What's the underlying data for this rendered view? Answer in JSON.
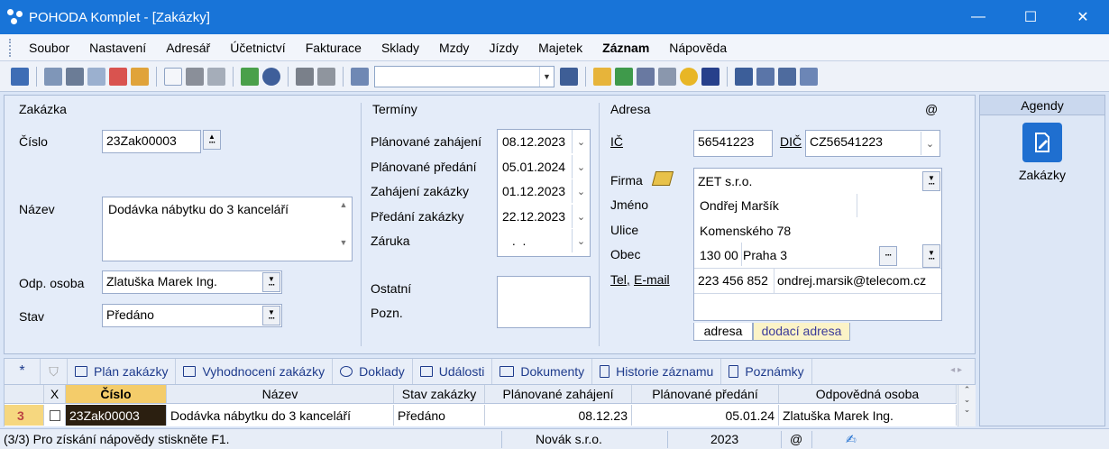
{
  "window": {
    "title": "POHODA Komplet - [Zakázky]",
    "minimize": "—",
    "maximize": "☐",
    "close": "✕"
  },
  "menu": [
    {
      "label": "Soubor"
    },
    {
      "label": "Nastavení"
    },
    {
      "label": "Adresář"
    },
    {
      "label": "Účetnictví"
    },
    {
      "label": "Fakturace"
    },
    {
      "label": "Sklady"
    },
    {
      "label": "Mzdy"
    },
    {
      "label": "Jízdy"
    },
    {
      "label": "Majetek"
    },
    {
      "label": "Záznam",
      "bold": true
    },
    {
      "label": "Nápověda"
    }
  ],
  "toolbar": {
    "combo_value": ""
  },
  "zakazka": {
    "section": "Zakázka",
    "cislo_label": "Číslo",
    "cislo_value": "23Zak00003",
    "nazev_label": "Název",
    "nazev_value": "Dodávka nábytku do 3 kanceláří",
    "odp_label": "Odp. osoba",
    "odp_value": "Zlatuška Marek Ing.",
    "stav_label": "Stav",
    "stav_value": "Předáno"
  },
  "terminy": {
    "section": "Termíny",
    "rows": [
      {
        "label": "Plánované zahájení",
        "value": "08.12.2023"
      },
      {
        "label": "Plánované předání",
        "value": "05.01.2024"
      },
      {
        "label": "Zahájení zakázky",
        "value": "01.12.2023"
      },
      {
        "label": "Předání zakázky",
        "value": "22.12.2023"
      },
      {
        "label": "Záruka",
        "value": " .  ."
      }
    ],
    "ostatni_label": "Ostatní",
    "pozn_label": "Pozn.",
    "ostatni_value": ""
  },
  "adresa": {
    "section": "Adresa",
    "at": "@",
    "ic_label": "IČ",
    "ic_value": "56541223",
    "dic_label": "DIČ",
    "dic_value": "CZ56541223",
    "firma_label": "Firma",
    "firma_value": "ZET s.r.o.",
    "jmeno_label": "Jméno",
    "jmeno_value": "Ondřej Maršík",
    "ulice_label": "Ulice",
    "ulice_value": "Komenského 78",
    "obec_label": "Obec",
    "psc_value": "130 00",
    "obec_value": "Praha 3",
    "tel_label": "Tel,",
    "email_label": "E-mail",
    "tel_value": "223 456 852",
    "email_value": "ondrej.marsik@telecom.cz",
    "tab1": "adresa",
    "tab2": "dodací adresa"
  },
  "agendy": {
    "head": "Agendy",
    "item": "Zakázky"
  },
  "tabs": [
    {
      "label": "Plán zakázky",
      "icon": "list-icon"
    },
    {
      "label": "Vyhodnocení zakázky",
      "icon": "list-icon"
    },
    {
      "label": "Doklady",
      "icon": "info-icon"
    },
    {
      "label": "Události",
      "icon": "list-icon"
    },
    {
      "label": "Dokumenty",
      "icon": "folder-icon"
    },
    {
      "label": "Historie záznamu",
      "icon": "page-icon"
    },
    {
      "label": "Poznámky",
      "icon": "page-icon"
    }
  ],
  "tabs_first": "*",
  "grid": {
    "headers": [
      "",
      "X",
      "Číslo",
      "Název",
      "Stav zakázky",
      "Plánované zahájení",
      "Plánované předání",
      "Odpovědná osoba"
    ],
    "row": [
      "3",
      "",
      "23Zak00003",
      "Dodávka nábytku do 3 kanceláří",
      "Předáno",
      "08.12.23",
      "05.01.24",
      "Zlatuška Marek Ing."
    ]
  },
  "status": {
    "help": "(3/3) Pro získání nápovědy stiskněte F1.",
    "company": "Novák  s.r.o.",
    "year": "2023",
    "at": "@"
  },
  "colors": {
    "titlebar": "#1874d8",
    "selected_cell": "#2b1f10",
    "accent": "#1f6fd0"
  }
}
